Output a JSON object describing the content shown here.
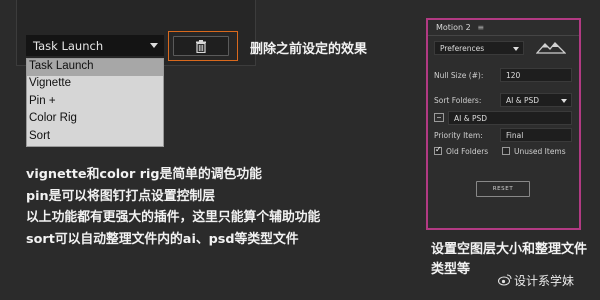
{
  "dropdown_demo": {
    "selected_value": "Task Launch",
    "options": [
      "Task Launch",
      "Vignette",
      "Pin +",
      "Color Rig",
      "Sort"
    ],
    "delete_button_icon": "trash-icon",
    "annotation": "删除之前设定的效果"
  },
  "description": {
    "lines": [
      "vignette和color rig是简单的调色功能",
      "pin是可以将图钉打点设置控制层",
      "以上功能都有更强大的插件，这里只能算个辅助功能",
      "sort可以自动整理文件内的ai、psd等类型文件"
    ]
  },
  "motion_panel": {
    "title": "Motion 2",
    "menu_icon": "hamburger-menu-icon",
    "preferences_label": "Preferences",
    "logo_icon": "mountain-logo-icon",
    "null_size_label": "Null Size (#):",
    "null_size_value": "120",
    "sort_folders_label": "Sort Folders:",
    "sort_folders_value": "AI & PSD",
    "folder_name_value": "AI & PSD",
    "priority_label": "Priority Item:",
    "priority_value": "Final",
    "old_folders_label": "Old Folders",
    "old_folders_checked": true,
    "unused_items_label": "Unused Items",
    "unused_items_checked": false,
    "reset_label": "RESET",
    "highlight_color": "#b23a83"
  },
  "right_annotation": "设置空图层大小和整理文件类型等",
  "watermark": {
    "text": "设计系学妹"
  }
}
